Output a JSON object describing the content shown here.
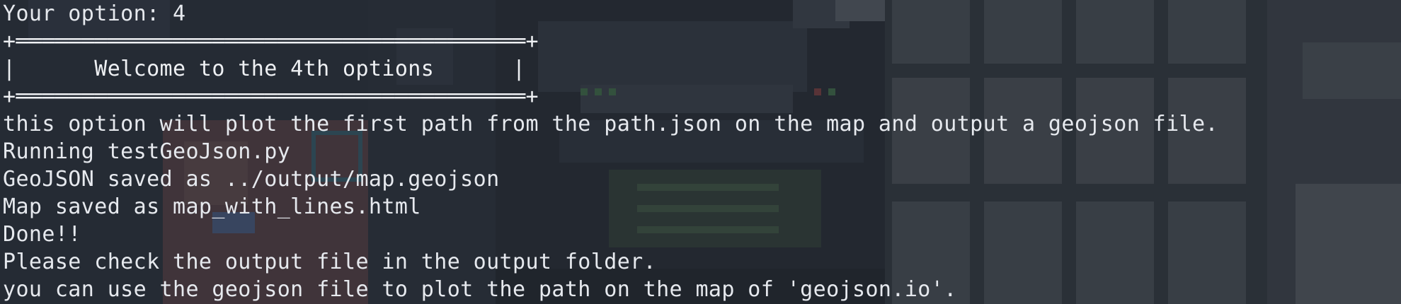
{
  "terminal": {
    "lines": {
      "prompt": "Your option: 4",
      "box_top": "+═══════════════════════════════════════+",
      "box_title": "|      Welcome to the 4th options      |",
      "box_bottom": "+═══════════════════════════════════════+",
      "description": "this option will plot the first path from the path.json on the map and output a geojson file.",
      "running": "Running testGeoJson.py",
      "geojson_saved": "GeoJSON saved as ../output/map.geojson",
      "map_saved": "Map saved as map_with_lines.html",
      "done": "Done!!",
      "check_output": "Please check the output file in the output folder.",
      "hint": "you can use the geojson file to plot the path on the map of 'geojson.io'."
    }
  },
  "theme": {
    "background": "#2e333b",
    "text": "#e6e9ee"
  }
}
